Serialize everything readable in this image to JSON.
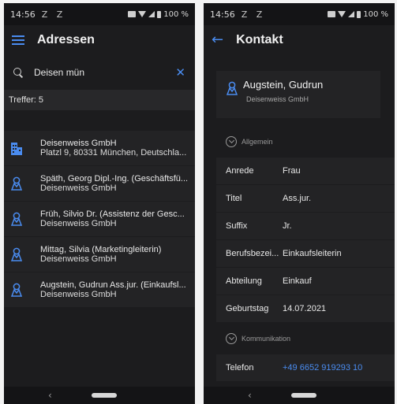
{
  "status_bar": {
    "time": "14:56",
    "z_icons": "Z Z",
    "battery": "100 %"
  },
  "left": {
    "title": "Adressen",
    "search": {
      "value": "Deisen mün",
      "placeholder": ""
    },
    "hits": "Treffer: 5",
    "items": [
      {
        "icon": "building-icon",
        "line1": "Deisenweiss GmbH",
        "line2": "Platzl 9, 80331 München, Deutschla..."
      },
      {
        "icon": "person-icon",
        "line1": "Späth, Georg Dipl.-Ing. (Geschäftsfü...",
        "line2": "Deisenweiss GmbH"
      },
      {
        "icon": "person-icon",
        "line1": "Früh, Silvio Dr. (Assistenz der Gesc...",
        "line2": "Deisenweiss GmbH"
      },
      {
        "icon": "person-icon",
        "line1": "Mittag, Silvia (Marketingleiterin)",
        "line2": "Deisenweiss GmbH"
      },
      {
        "icon": "person-icon",
        "line1": "Augstein, Gudrun Ass.jur. (Einkaufsl...",
        "line2": "Deisenweiss GmbH"
      }
    ]
  },
  "right": {
    "title": "Kontakt",
    "contact": {
      "name": "Augstein, Gudrun",
      "company": "Deisenweiss GmbH"
    },
    "section_general": "Allgemein",
    "fields": [
      {
        "label": "Anrede",
        "value": "Frau"
      },
      {
        "label": "Titel",
        "value": "Ass.jur."
      },
      {
        "label": "Suffix",
        "value": "Jr."
      },
      {
        "label": "Berufsbezei...",
        "value": "Einkaufsleiterin"
      },
      {
        "label": "Abteilung",
        "value": "Einkauf"
      },
      {
        "label": "Geburtstag",
        "value": "14.07.2021"
      }
    ],
    "section_comm": "Kommunikation",
    "phone": {
      "label": "Telefon",
      "value": "+49 6652 919293 10"
    }
  },
  "colors": {
    "accent": "#4a8cf0",
    "background": "#1c1c1e",
    "card": "#232325"
  }
}
